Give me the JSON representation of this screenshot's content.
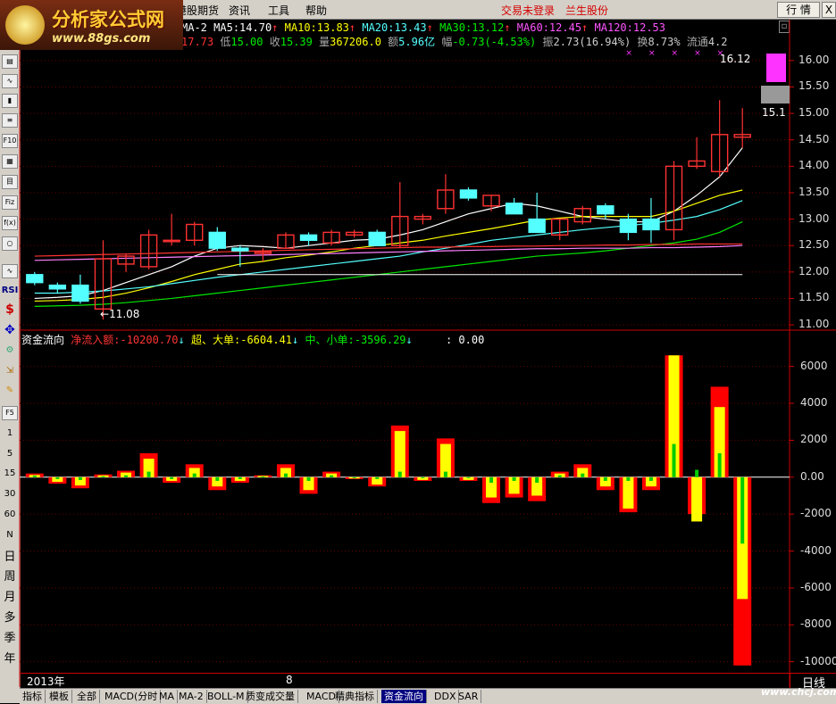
{
  "logo": {
    "title": "分析家公式网",
    "url": "www.88gs.com"
  },
  "menu": {
    "items": [
      "港股期货",
      "资讯",
      "工具",
      "帮助"
    ],
    "status_login": "交易未登录",
    "broker": "兰生股份",
    "btn_quote": "行 情",
    "btn_hint": "?",
    "btn_close": "X"
  },
  "header": {
    "ma2": "MA-2",
    "ma5_label": "MA5:",
    "ma5": "14.70",
    "ma10_label": "MA10:",
    "ma10": "13.83",
    "ma20_label": "MA20:",
    "ma20": "13.43",
    "ma30_label": "MA30:",
    "ma30": "13.12",
    "ma60_label": "MA60:",
    "ma60": "12.45",
    "ma120_label": "MA120:",
    "ma120": "12.53",
    "up_arrow": "↑",
    "close_left": "17.73",
    "low_label": "低",
    "low": "15.00",
    "close_label": "收",
    "close": "15.39",
    "vol_label": "量",
    "vol": "367206.0",
    "amt_label": "额",
    "amt": "5.96亿",
    "chg_label": "幅",
    "chg": "-0.73",
    "chg_pct": "(-4.53%)",
    "amp_label": "振",
    "amp": "2.73",
    "amp_pct": "(16.94%)",
    "turn_label": "换",
    "turn": "8.73%",
    "float_label": "流通",
    "float": "4.2"
  },
  "price_axis": [
    "16.00",
    "15.50",
    "15.00",
    "14.50",
    "14.00",
    "13.50",
    "13.00",
    "12.50",
    "12.00",
    "11.50",
    "11.00"
  ],
  "flow_axis": [
    "6000",
    "4000",
    "2000",
    "0.00",
    "-2000",
    "-4000",
    "-6000",
    "-8000",
    "-10000"
  ],
  "annotations": {
    "high": "16.12",
    "low": "11.08",
    "last": "15.1"
  },
  "flow_header": {
    "title": "资金流向",
    "net_label": "净流入额:",
    "net": "-10200.70",
    "down": "↓",
    "big_label": "超、大单:",
    "big": "-6604.41",
    "mid_label": "中、小单:",
    "mid": "-3596.29",
    "extra": ": 0.00"
  },
  "date_bar": {
    "year": "2013年",
    "month": "8",
    "period": "日线"
  },
  "left_toolbar": [
    "RSI",
    "$",
    "F5",
    "1",
    "5",
    "15",
    "30",
    "60",
    "N",
    "日",
    "周",
    "月",
    "多",
    "季",
    "年"
  ],
  "bottom_tabs": [
    "指标",
    "模板",
    "全部",
    "MACD(分时",
    "MA",
    "MA-2",
    "BOLL-M",
    "质变成交量",
    "MACD",
    "精典指标",
    "资金流向",
    "DDX",
    "SAR"
  ],
  "active_tab": "资金流向",
  "watermark": "www.chcj.com",
  "colors": {
    "up": "#ff3232",
    "down": "#54ffff",
    "ma5": "#ffffff",
    "ma10": "#ffff00",
    "ma20": "#ff80ff",
    "ma30": "#00e600",
    "flow_big": "#ff0000",
    "flow_mid": "#ffff00",
    "flow_small": "#00cc00"
  },
  "chart_data": [
    {
      "type": "candlestick",
      "ylim": [
        10.9,
        16.2
      ],
      "candles": [
        {
          "o": 11.95,
          "h": 12.0,
          "l": 11.75,
          "c": 11.8
        },
        {
          "o": 11.75,
          "h": 11.8,
          "l": 11.6,
          "c": 11.68
        },
        {
          "o": 11.75,
          "h": 11.95,
          "l": 11.4,
          "c": 11.45
        },
        {
          "o": 11.3,
          "h": 12.6,
          "l": 11.1,
          "c": 12.25
        },
        {
          "o": 12.15,
          "h": 12.35,
          "l": 12.0,
          "c": 12.3
        },
        {
          "o": 12.1,
          "h": 12.8,
          "l": 12.05,
          "c": 12.7
        },
        {
          "o": 12.6,
          "h": 13.1,
          "l": 12.5,
          "c": 12.6
        },
        {
          "o": 12.6,
          "h": 12.95,
          "l": 12.5,
          "c": 12.9
        },
        {
          "o": 12.75,
          "h": 12.85,
          "l": 12.4,
          "c": 12.45
        },
        {
          "o": 12.45,
          "h": 12.5,
          "l": 12.1,
          "c": 12.4
        },
        {
          "o": 12.35,
          "h": 12.45,
          "l": 12.2,
          "c": 12.38
        },
        {
          "o": 12.45,
          "h": 12.75,
          "l": 12.45,
          "c": 12.7
        },
        {
          "o": 12.7,
          "h": 12.75,
          "l": 12.5,
          "c": 12.6
        },
        {
          "o": 12.55,
          "h": 12.8,
          "l": 12.5,
          "c": 12.75
        },
        {
          "o": 12.7,
          "h": 12.8,
          "l": 12.65,
          "c": 12.75
        },
        {
          "o": 12.75,
          "h": 12.8,
          "l": 12.5,
          "c": 12.5
        },
        {
          "o": 12.5,
          "h": 13.7,
          "l": 12.45,
          "c": 13.05
        },
        {
          "o": 13.0,
          "h": 13.1,
          "l": 12.9,
          "c": 13.05
        },
        {
          "o": 13.2,
          "h": 13.85,
          "l": 13.1,
          "c": 13.55
        },
        {
          "o": 13.55,
          "h": 13.6,
          "l": 13.35,
          "c": 13.4
        },
        {
          "o": 13.25,
          "h": 13.45,
          "l": 13.15,
          "c": 13.45
        },
        {
          "o": 13.3,
          "h": 13.4,
          "l": 13.1,
          "c": 13.1
        },
        {
          "o": 13.0,
          "h": 13.5,
          "l": 12.8,
          "c": 12.75
        },
        {
          "o": 12.7,
          "h": 13.0,
          "l": 12.6,
          "c": 13.0
        },
        {
          "o": 12.95,
          "h": 13.25,
          "l": 12.9,
          "c": 13.2
        },
        {
          "o": 13.25,
          "h": 13.3,
          "l": 13.0,
          "c": 13.1
        },
        {
          "o": 13.0,
          "h": 13.1,
          "l": 12.6,
          "c": 12.75
        },
        {
          "o": 13.0,
          "h": 13.4,
          "l": 12.55,
          "c": 12.8
        },
        {
          "o": 12.8,
          "h": 14.1,
          "l": 12.6,
          "c": 14.0
        },
        {
          "o": 14.0,
          "h": 14.55,
          "l": 13.95,
          "c": 14.1
        },
        {
          "o": 13.9,
          "h": 15.25,
          "l": 13.8,
          "c": 14.6
        },
        {
          "o": 14.55,
          "h": 15.1,
          "l": 14.35,
          "c": 14.6
        }
      ],
      "ma_lines": {
        "ma5": [
          11.5,
          11.52,
          11.55,
          11.65,
          11.8,
          11.95,
          12.1,
          12.3,
          12.45,
          12.5,
          12.48,
          12.45,
          12.5,
          12.55,
          12.6,
          12.62,
          12.7,
          12.8,
          12.95,
          13.1,
          13.2,
          13.3,
          13.25,
          13.15,
          13.05,
          13.0,
          12.95,
          12.95,
          13.15,
          13.45,
          13.8,
          14.35
        ],
        "ma10": [
          11.45,
          11.46,
          11.48,
          11.52,
          11.6,
          11.7,
          11.82,
          11.95,
          12.05,
          12.15,
          12.2,
          12.27,
          12.32,
          12.38,
          12.45,
          12.5,
          12.55,
          12.6,
          12.68,
          12.75,
          12.82,
          12.9,
          12.98,
          13.02,
          13.05,
          13.05,
          13.05,
          13.05,
          13.15,
          13.3,
          13.45,
          13.55
        ],
        "ma20": [
          11.6,
          11.6,
          11.62,
          11.64,
          11.68,
          11.72,
          11.78,
          11.84,
          11.9,
          11.95,
          12.0,
          12.05,
          12.1,
          12.15,
          12.2,
          12.25,
          12.3,
          12.38,
          12.45,
          12.52,
          12.6,
          12.65,
          12.7,
          12.75,
          12.8,
          12.84,
          12.88,
          12.92,
          12.98,
          13.05,
          13.18,
          13.35
        ],
        "ma30": [
          11.35,
          11.36,
          11.37,
          11.39,
          11.42,
          11.46,
          11.5,
          11.55,
          11.6,
          11.65,
          11.7,
          11.75,
          11.8,
          11.85,
          11.9,
          11.95,
          12.0,
          12.05,
          12.1,
          12.15,
          12.2,
          12.25,
          12.3,
          12.33,
          12.36,
          12.4,
          12.45,
          12.5,
          12.55,
          12.62,
          12.75,
          12.95
        ],
        "ma60": [
          12.22,
          12.23,
          12.24,
          12.25,
          12.26,
          12.27,
          12.28,
          12.29,
          12.3,
          12.31,
          12.32,
          12.33,
          12.34,
          12.35,
          12.36,
          12.37,
          12.38,
          12.39,
          12.4,
          12.41,
          12.42,
          12.43,
          12.44,
          12.44,
          12.45,
          12.45,
          12.45,
          12.46,
          12.46,
          12.47,
          12.48,
          12.5
        ],
        "ma120": [
          12.3,
          12.31,
          12.32,
          12.33,
          12.34,
          12.35,
          12.36,
          12.37,
          12.38,
          12.39,
          12.4,
          12.41,
          12.42,
          12.43,
          12.44,
          12.45,
          12.46,
          12.47,
          12.47,
          12.48,
          12.48,
          12.49,
          12.49,
          12.5,
          12.5,
          12.51,
          12.51,
          12.52,
          12.52,
          12.53,
          12.53,
          12.53
        ]
      }
    },
    {
      "type": "bar",
      "title": "资金流向",
      "ylim": [
        -10500,
        7000
      ],
      "series": [
        {
          "name": "净流入额",
          "values": [
            200,
            -350,
            -600,
            150,
            350,
            1300,
            -300,
            700,
            -700,
            -300,
            100,
            700,
            -900,
            300,
            -100,
            -500,
            2800,
            -200,
            2100,
            -200,
            -1400,
            -1100,
            -1300,
            300,
            700,
            -700,
            -1900,
            -700,
            6600,
            -2000,
            4900,
            -10200
          ]
        },
        {
          "name": "超、大单",
          "values": [
            120,
            -250,
            -450,
            100,
            250,
            1000,
            -200,
            500,
            -500,
            -200,
            70,
            500,
            -700,
            200,
            -70,
            -400,
            2500,
            -150,
            1800,
            -150,
            -1100,
            -900,
            -1000,
            200,
            500,
            -500,
            -1700,
            -500,
            6600,
            -2400,
            3800,
            -6600
          ]
        },
        {
          "name": "中、小单",
          "values": [
            80,
            -100,
            -150,
            50,
            100,
            300,
            -100,
            200,
            -200,
            -100,
            30,
            200,
            -200,
            100,
            -30,
            -100,
            300,
            -50,
            300,
            -50,
            -300,
            -200,
            -300,
            100,
            200,
            -200,
            -200,
            -200,
            1800,
            400,
            1300,
            -3600
          ]
        }
      ]
    }
  ]
}
